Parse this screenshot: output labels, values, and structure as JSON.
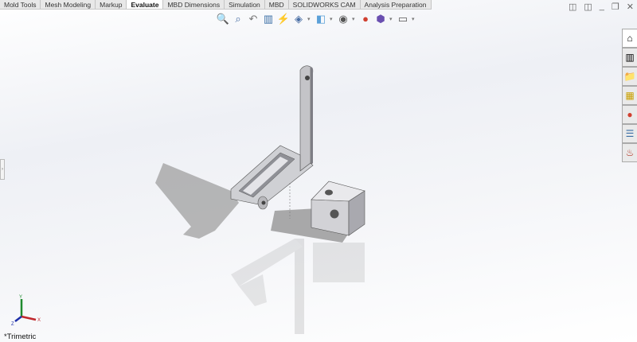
{
  "tabs": [
    {
      "label": "Mold Tools"
    },
    {
      "label": "Mesh Modeling"
    },
    {
      "label": "Markup"
    },
    {
      "label": "Evaluate",
      "active": true
    },
    {
      "label": "MBD Dimensions"
    },
    {
      "label": "Simulation"
    },
    {
      "label": "MBD"
    },
    {
      "label": "SOLIDWORKS CAM"
    },
    {
      "label": "Analysis Preparation"
    }
  ],
  "toolbar": [
    "zoom-to-fit-icon",
    "zoom-to-area-icon",
    "previous-view-icon",
    "section-view-icon",
    "dynamic-annotation-icon",
    "view-orientation-icon",
    "display-style-icon",
    "hide-show-items-icon",
    "edit-appearance-icon",
    "apply-scene-icon",
    "view-settings-icon"
  ],
  "view": {
    "orientation": "*Trimetric",
    "axes": {
      "x": "X",
      "y": "Y",
      "z": "Z"
    }
  },
  "colors": {
    "x": "#c0282d",
    "y": "#1f8a2e",
    "z": "#1d2fa8"
  }
}
